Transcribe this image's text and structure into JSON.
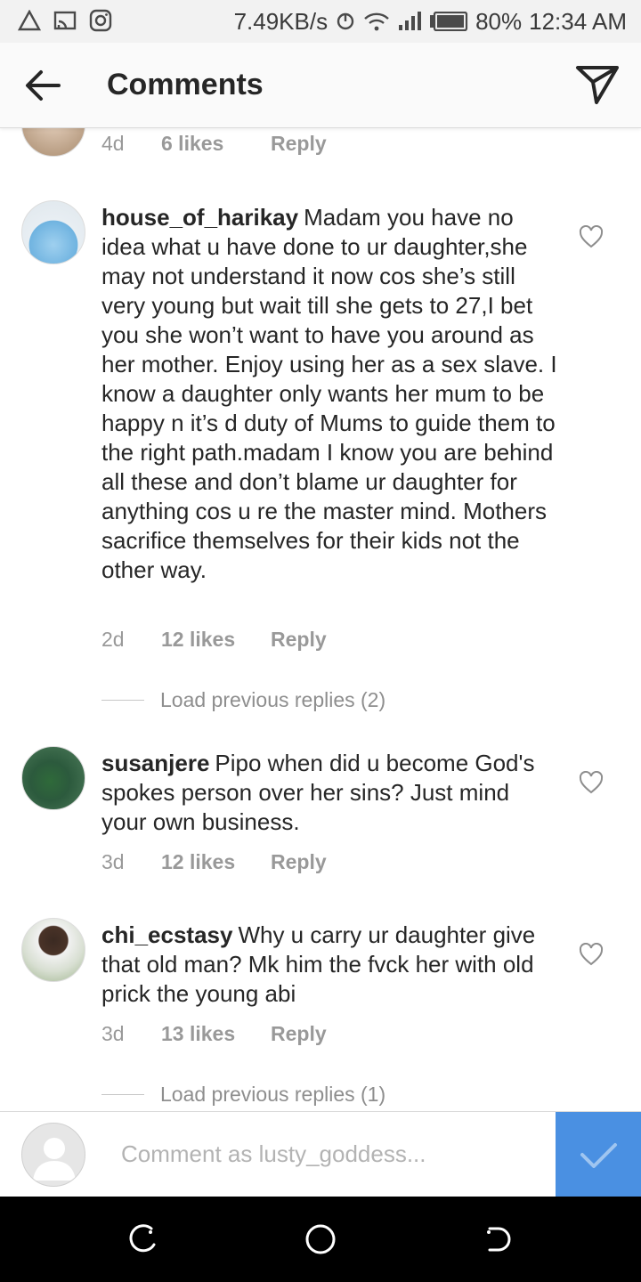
{
  "status_bar": {
    "speed": "7.49KB/s",
    "battery": "80%",
    "time": "12:34 AM"
  },
  "header": {
    "title": "Comments"
  },
  "partial_comment": {
    "time": "4d",
    "likes": "6 likes",
    "reply": "Reply"
  },
  "comments": [
    {
      "username": "house_of_harikay",
      "text": "Madam you have no idea what u have done to ur daughter,she may not understand it now cos she’s still very young but wait till she gets to 27,I bet you she won’t want to have you around as her mother. Enjoy using her as a sex slave. I know a daughter only wants her mum to be happy n it’s d duty of Mums to guide them to the right path.madam I know you are behind all these and don’t blame ur daughter for anything cos u re the master mind. Mothers sacrifice themselves for their kids not the other way.",
      "time": "2d",
      "likes": "12 likes",
      "reply": "Reply"
    },
    {
      "username": "susanjere",
      "text": "Pipo when did u become God's spokes person over her sins? Just mind your own business.",
      "time": "3d",
      "likes": "12 likes",
      "reply": "Reply"
    },
    {
      "username": "chi_ecstasy",
      "text": "Why u carry ur daughter give that old man? Mk him the fvck her with old prick the young abi",
      "time": "3d",
      "likes": "13 likes",
      "reply": "Reply"
    }
  ],
  "load_previous": [
    "Load previous replies (2)",
    "Load previous replies (1)"
  ],
  "composer": {
    "placeholder": "Comment as lusty_goddess..."
  },
  "colors": {
    "accent": "#4a90e2",
    "meta_text": "#999999",
    "text": "#262626"
  }
}
